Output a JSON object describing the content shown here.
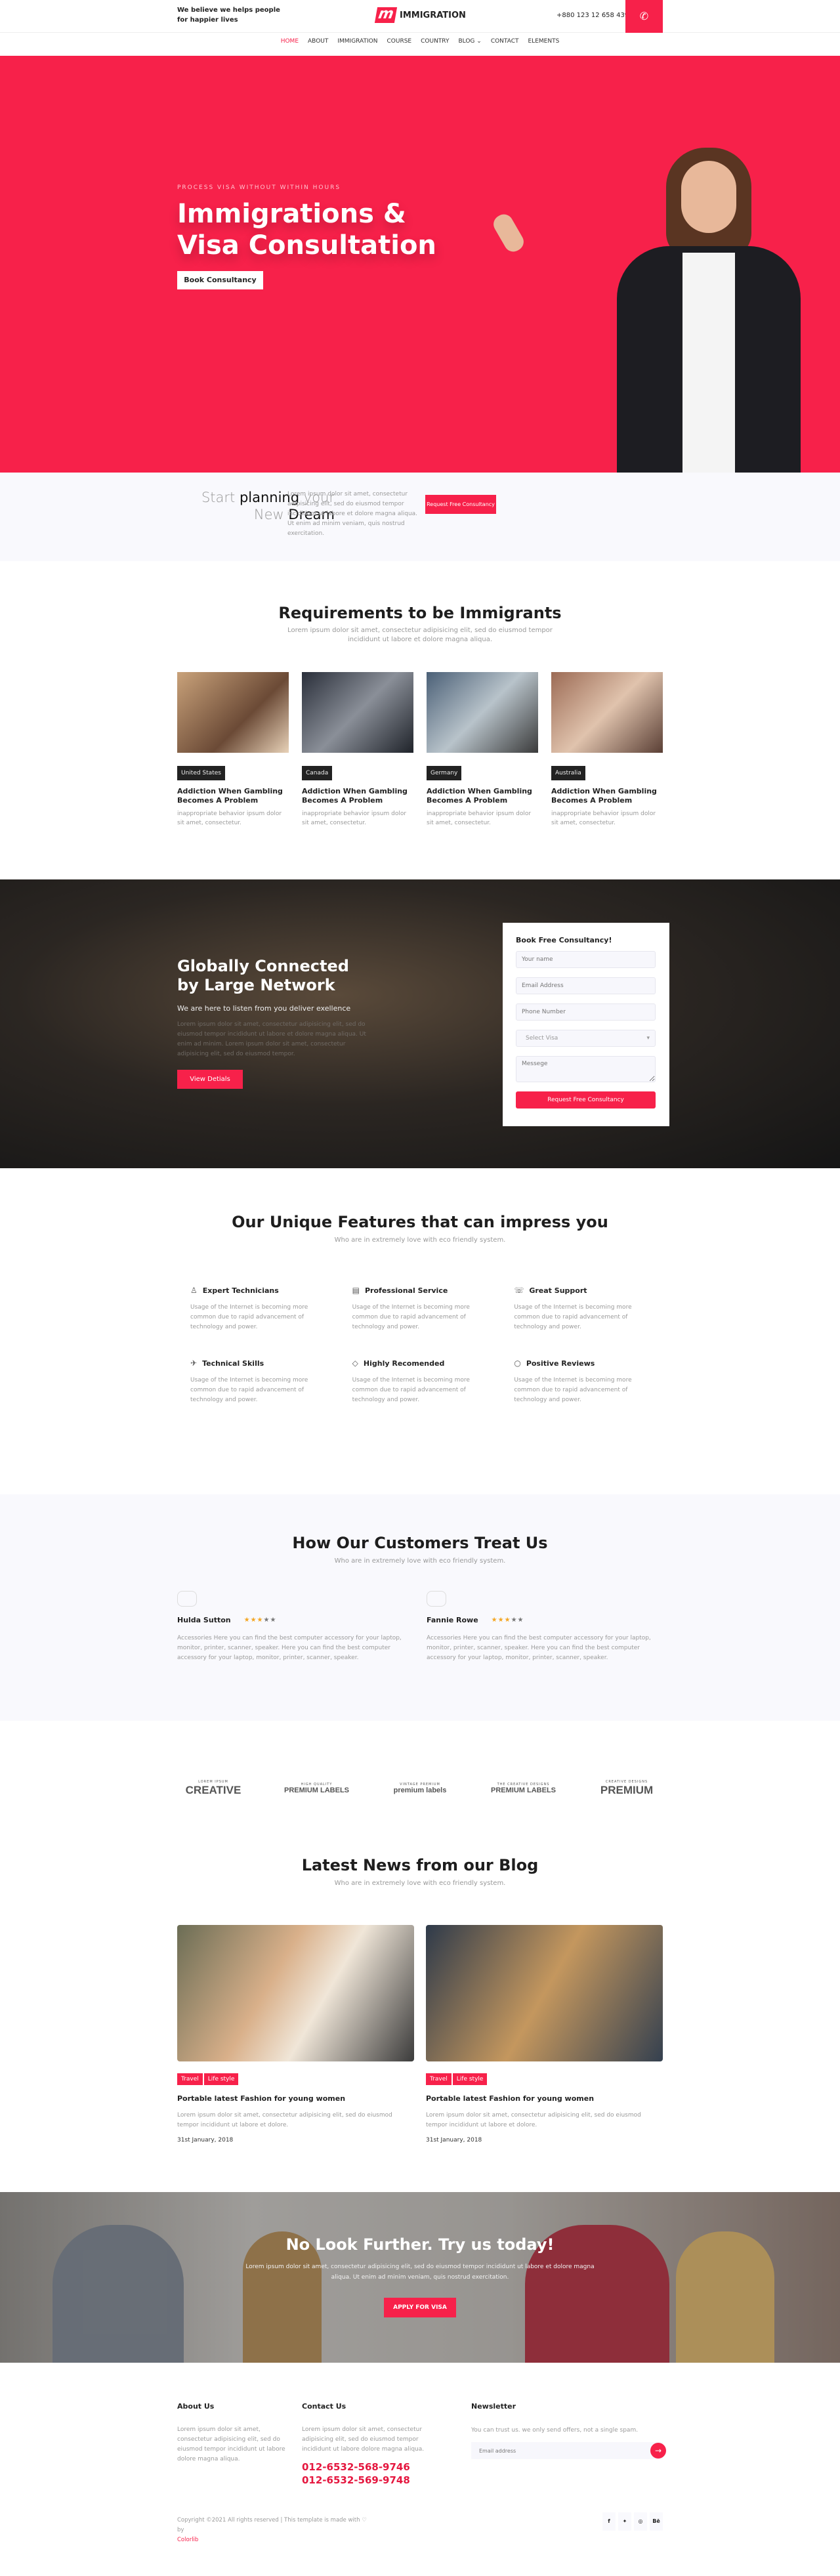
{
  "colors": {
    "accent": "#f7214a",
    "dark": "#1e1e1e",
    "light_bg": "#f9f9fd"
  },
  "header": {
    "tagline_line1": "We believe we helps people",
    "tagline_line2": "for happier lives",
    "brand": "IMMIGRATION",
    "phone": "+880 123 12 658 439",
    "phone_icon": "phone-icon"
  },
  "nav": {
    "items": [
      {
        "label": "HOME",
        "active": true
      },
      {
        "label": "ABOUT"
      },
      {
        "label": "IMMIGRATION"
      },
      {
        "label": "COURSE"
      },
      {
        "label": "COUNTRY"
      },
      {
        "label": "BLOG ⌄"
      },
      {
        "label": "CONTACT"
      },
      {
        "label": "ELEMENTS"
      }
    ]
  },
  "hero": {
    "kicker": "PROCESS VISA WITHOUT WITHIN HOURS",
    "title_line1": "Immigrations &",
    "title_line2": "Visa Consultation",
    "button": "Book Consultancy"
  },
  "planning": {
    "w1": "Start",
    "w2": "planning",
    "w3": "your",
    "w4": "New",
    "w5": "Dream",
    "text": "Lorem ipsum dolor sit amet, consectetur adipisicing elit, sed do eiusmod tempor incididunt ut labore et dolore magna aliqua. Ut enim ad minim veniam, quis nostrud exercitation.",
    "button": "Request Free Consultancy"
  },
  "requirements": {
    "title": "Requirements to be Immigrants",
    "subtitle": "Lorem ipsum dolor sit amet, consectetur adipisicing elit, sed do eiusmod tempor incididunt ut labore et dolore magna aliqua.",
    "cards": [
      {
        "country": "United States",
        "title": "Addiction When Gambling Becomes A Problem",
        "text": "inappropriate behavior ipsum dolor sit amet, consectetur."
      },
      {
        "country": "Canada",
        "title": "Addiction When Gambling Becomes A Problem",
        "text": "inappropriate behavior ipsum dolor sit amet, consectetur."
      },
      {
        "country": "Germany",
        "title": "Addiction When Gambling Becomes A Problem",
        "text": "inappropriate behavior ipsum dolor sit amet, consectetur."
      },
      {
        "country": "Australia",
        "title": "Addiction When Gambling Becomes A Problem",
        "text": "inappropriate behavior ipsum dolor sit amet, consectetur."
      }
    ]
  },
  "network": {
    "title_line1": "Globally Connected",
    "title_line2": "by Large Network",
    "lead": "We are here to listen from you deliver exellence",
    "text": "Lorem ipsum dolor sit amet, consectetur adipisicing elit, sed do eiusmod tempor incididunt ut labore et dolore magna aliqua. Ut enim ad minim. Lorem ipsum dolor sit amet, consectetur adipisicing elit, sed do eiusmod tempor.",
    "button": "View Detials"
  },
  "form": {
    "title": "Book Free Consultancy!",
    "name_ph": "Your name",
    "email_ph": "Email Address",
    "phone_ph": "Phone Number",
    "visa_select": "Select Visa",
    "message_ph": "Messege",
    "submit": "Request Free Consultancy"
  },
  "features": {
    "title": "Our Unique Features that can impress you",
    "subtitle": "Who are in extremely love with eco friendly system.",
    "items": [
      {
        "icon": "user-icon",
        "glyph": "♙",
        "title": "Expert Technicians",
        "text": "Usage of the Internet is becoming more common due to rapid advancement of technology and power."
      },
      {
        "icon": "document-icon",
        "glyph": "▤",
        "title": "Professional Service",
        "text": "Usage of the Internet is becoming more common due to rapid advancement of technology and power."
      },
      {
        "icon": "telephone-icon",
        "glyph": "☏",
        "title": "Great Support",
        "text": "Usage of the Internet is becoming more common due to rapid advancement of technology and power."
      },
      {
        "icon": "rocket-icon",
        "glyph": "✈",
        "title": "Technical Skills",
        "text": "Usage of the Internet is becoming more common due to rapid advancement of technology and power."
      },
      {
        "icon": "diamond-icon",
        "glyph": "◇",
        "title": "Highly Recomended",
        "text": "Usage of the Internet is becoming more common due to rapid advancement of technology and power."
      },
      {
        "icon": "chat-icon",
        "glyph": "○",
        "title": "Positive Reviews",
        "text": "Usage of the Internet is becoming more common due to rapid advancement of technology and power."
      }
    ]
  },
  "testimonials": {
    "title": "How Our Customers Treat Us",
    "subtitle": "Who are in extremely love with eco friendly system.",
    "items": [
      {
        "name": "Hulda Sutton",
        "rating": 3,
        "max": 5,
        "text": "Accessories Here you can find the best computer accessory for your laptop, monitor, printer, scanner, speaker. Here you can find the best computer accessory for your laptop, monitor, printer, scanner, speaker."
      },
      {
        "name": "Fannie Rowe",
        "rating": 3,
        "max": 5,
        "text": "Accessories Here you can find the best computer accessory for your laptop, monitor, printer, scanner, speaker. Here you can find the best computer accessory for your laptop, monitor, printer, scanner, speaker."
      }
    ]
  },
  "brands": [
    {
      "main": "CREATIVE",
      "sub": "LOREM IPSUM"
    },
    {
      "main": "PREMIUM LABELS",
      "sub": "HIGH QUALITY"
    },
    {
      "main": "premium labels",
      "sub": "VINTAGE PREMIUM"
    },
    {
      "main": "PREMIUM LABELS",
      "sub": "THE CREATIVE DESIGNS"
    },
    {
      "main": "PREMIUM",
      "sub": "CREATIVE DESIGNS"
    }
  ],
  "blog": {
    "title": "Latest News from our Blog",
    "subtitle": "Who are in extremely love with eco friendly system.",
    "posts": [
      {
        "tags": [
          "Travel",
          "Life style"
        ],
        "title": "Portable latest Fashion for young women",
        "text": "Lorem ipsum dolor sit amet, consectetur adipisicing elit, sed do eiusmod tempor incididunt ut labore et dolore.",
        "date": "31st January, 2018"
      },
      {
        "tags": [
          "Travel",
          "Life style"
        ],
        "title": "Portable latest Fashion for young women",
        "text": "Lorem ipsum dolor sit amet, consectetur adipisicing elit, sed do eiusmod tempor incididunt ut labore et dolore.",
        "date": "31st January, 2018"
      }
    ]
  },
  "cta": {
    "title": "No Look Further. Try us today!",
    "text": "Lorem ipsum dolor sit amet, consectetur adipisicing elit, sed do eiusmod tempor incididunt ut labore et dolore magna aliqua. Ut enim ad minim veniam, quis nostrud exercitation.",
    "button": "APPLY FOR VISA"
  },
  "footer": {
    "about_title": "About Us",
    "about_text": "Lorem ipsum dolor sit amet, consectetur adipisicing elit, sed do eiusmod tempor incididunt ut labore dolore magna aliqua.",
    "contact_title": "Contact Us",
    "contact_text": "Lorem ipsum dolor sit amet, consectetur adipisicing elit, sed do eiusmod tempor incididunt ut labore dolore magna aliqua.",
    "phone1": "012-6532-568-9746",
    "phone2": "012-6532-569-9748",
    "news_title": "Newsletter",
    "news_text": "You can trust us. we only send offers, not a single spam.",
    "email_ph": "Email address",
    "copyright": "Copyright ©2021 All rights reserved | This template is made with ♡ by",
    "credit": "Colorlib",
    "social": [
      "f",
      "✦",
      "◎",
      "Bē"
    ]
  }
}
